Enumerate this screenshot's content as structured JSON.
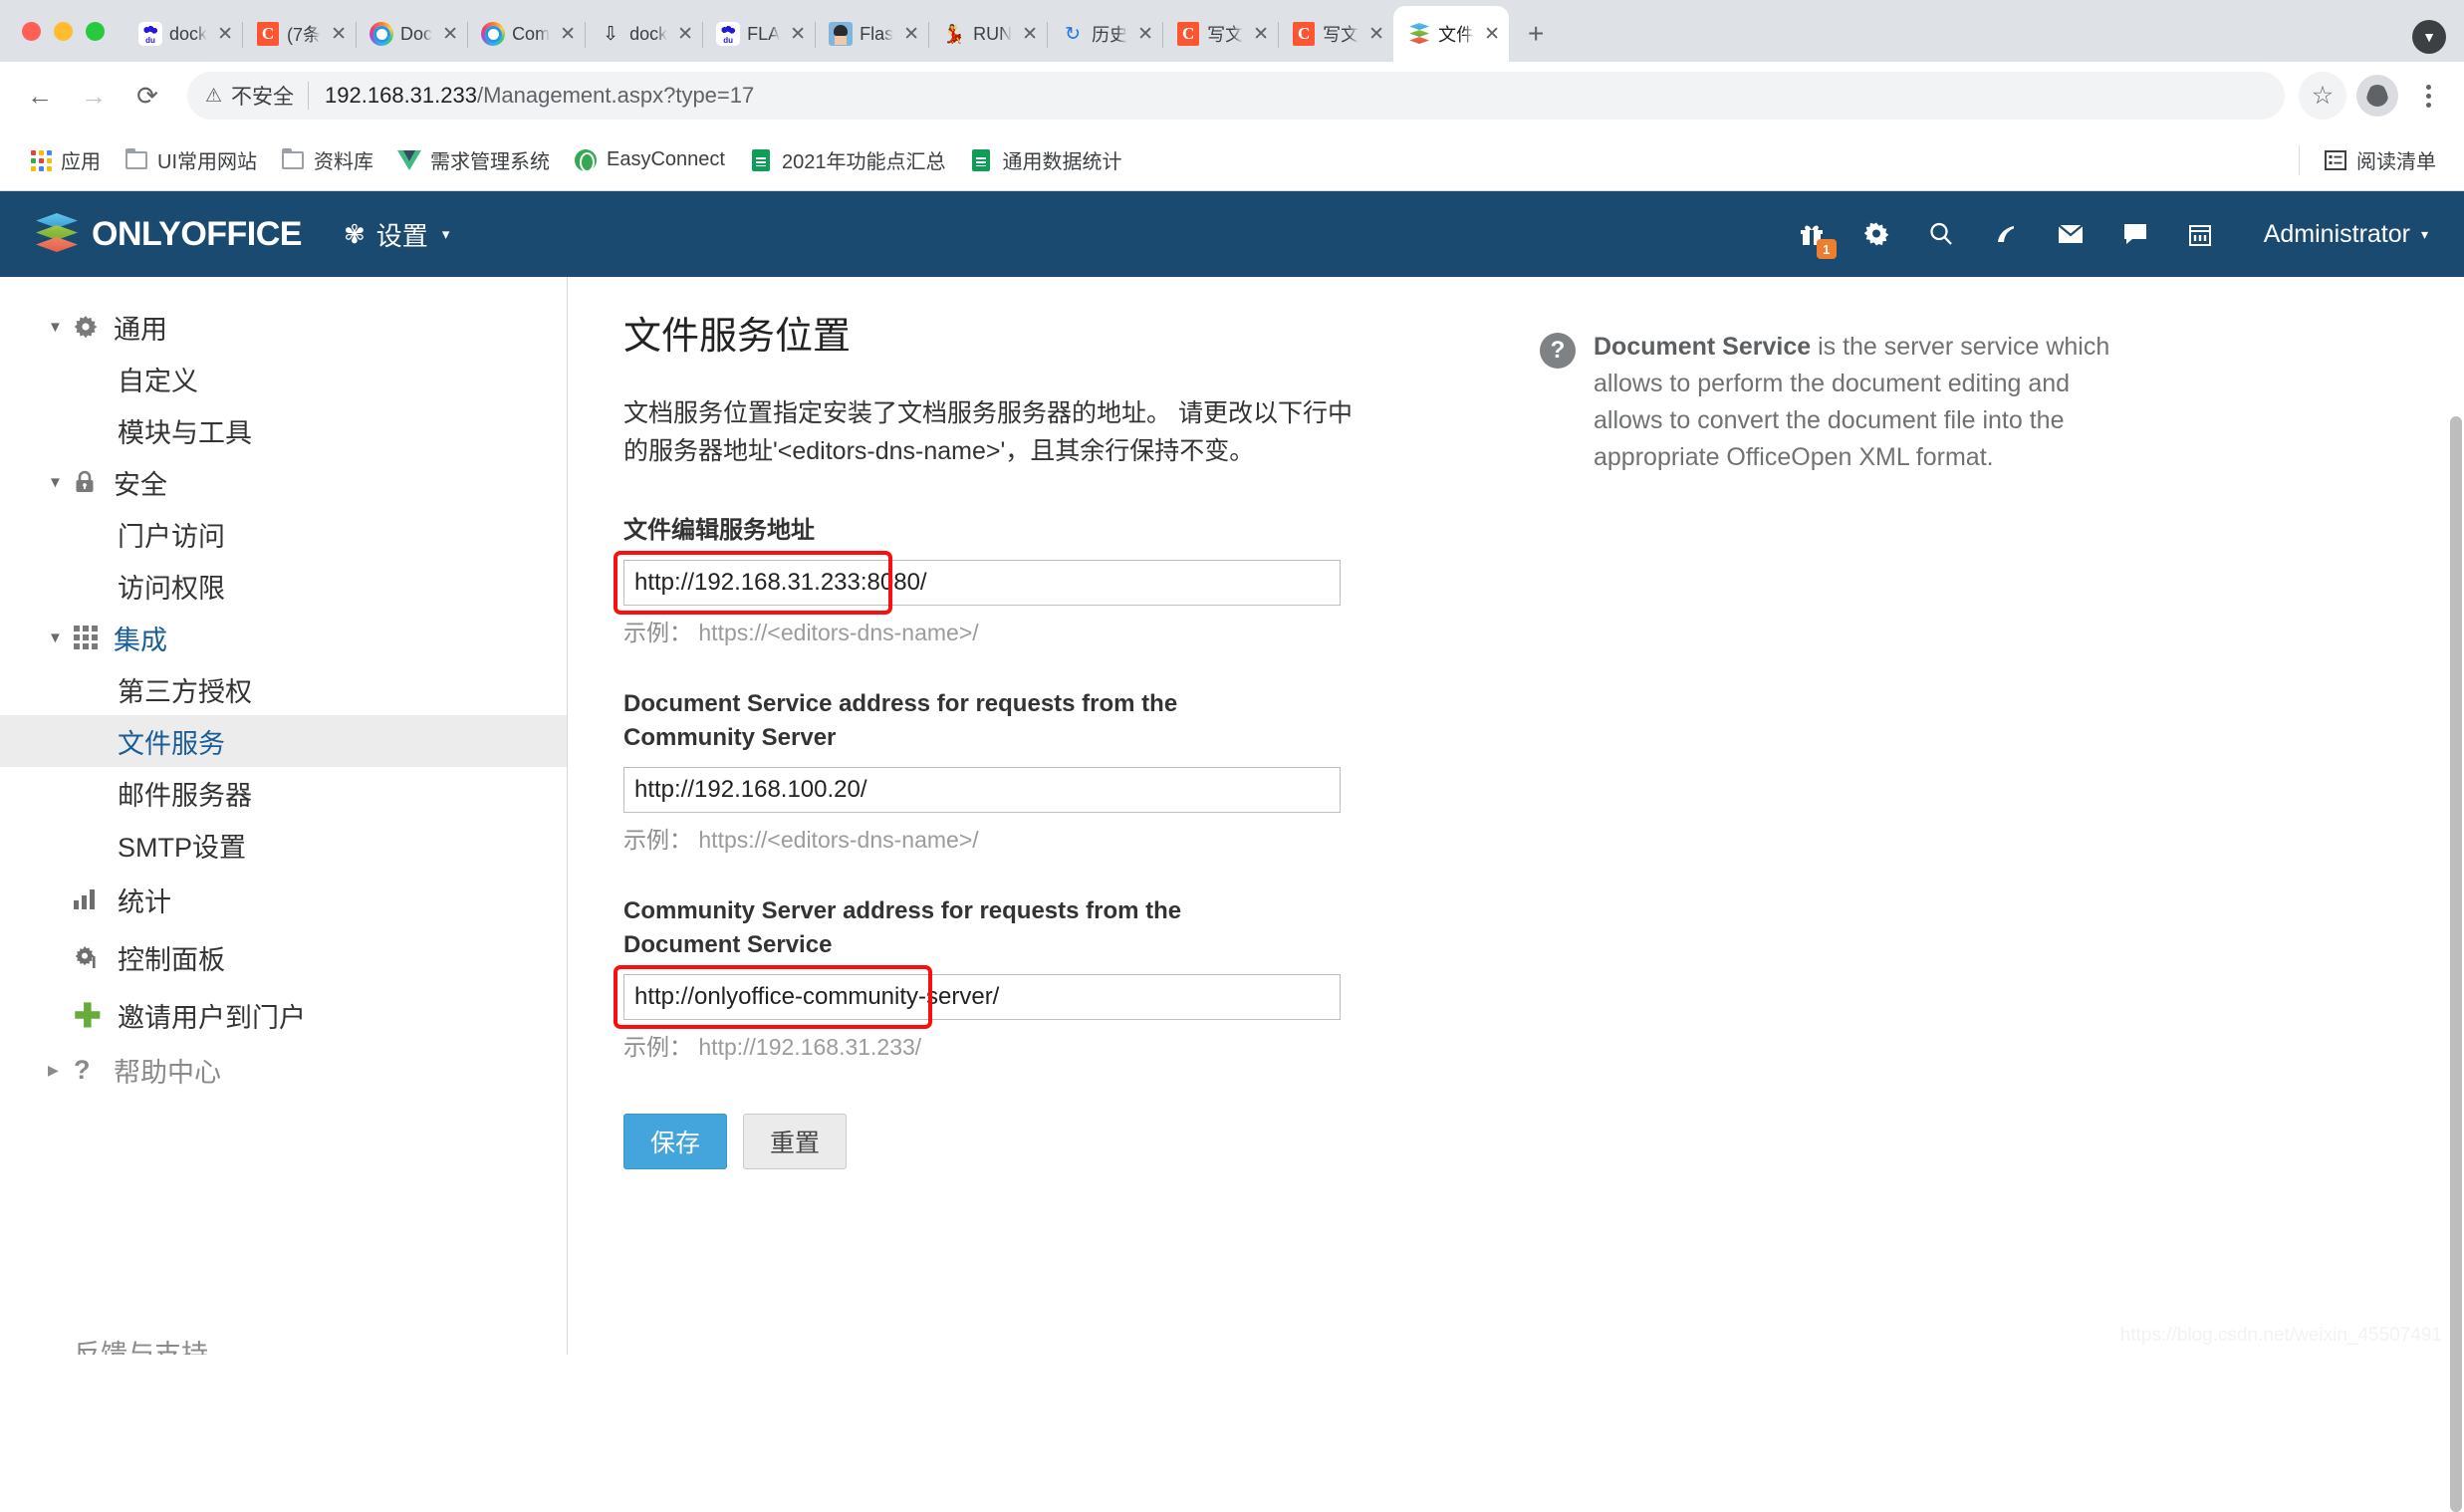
{
  "browser": {
    "tabs": [
      {
        "title": "dock",
        "favicon": "baidu-icon",
        "active": false
      },
      {
        "title": "(7条",
        "favicon": "csdn-icon",
        "active": false
      },
      {
        "title": "Doc",
        "favicon": "docker-icon",
        "active": false
      },
      {
        "title": "Com",
        "favicon": "docker-icon",
        "active": false
      },
      {
        "title": "dock",
        "favicon": "hand-icon",
        "active": false
      },
      {
        "title": "FLA",
        "favicon": "baidu-icon",
        "active": false
      },
      {
        "title": "Flas",
        "favicon": "avatar-icon",
        "active": false
      },
      {
        "title": "RUN",
        "favicon": "run-icon",
        "active": false
      },
      {
        "title": "历史",
        "favicon": "history-icon",
        "active": false
      },
      {
        "title": "写文",
        "favicon": "csdn-icon",
        "active": false
      },
      {
        "title": "写文",
        "favicon": "csdn-icon",
        "active": false
      },
      {
        "title": "文件",
        "favicon": "onlyoffice-icon",
        "active": true
      }
    ],
    "new_tab_label": "+",
    "tab_close_label": "✕",
    "tab_list_caret": "▼",
    "back_label": "←",
    "forward_label": "→",
    "reload_label": "⟳",
    "security": {
      "icon": "warning-triangle-icon",
      "icon_glyph": "⚠",
      "label": "不安全"
    },
    "url_host": "192.168.31.233",
    "url_path": "/Management.aspx?type=17",
    "star_label": "☆",
    "bookmarks": [
      {
        "label": "应用",
        "icon": "apps-grid-icon"
      },
      {
        "label": "UI常用网站",
        "icon": "folder-icon"
      },
      {
        "label": "资料库",
        "icon": "folder-icon"
      },
      {
        "label": "需求管理系统",
        "icon": "vue-icon"
      },
      {
        "label": "EasyConnect",
        "icon": "globe-icon"
      },
      {
        "label": "2021年功能点汇总",
        "icon": "sheets-icon"
      },
      {
        "label": "通用数据统计",
        "icon": "sheets-icon"
      }
    ],
    "reading_list": {
      "label": "阅读清单",
      "icon": "reading-list-icon"
    }
  },
  "app": {
    "brand": "ONLYOFFICE",
    "settings_menu": {
      "label": "设置",
      "icon": "gear-icon",
      "caret": "▾"
    },
    "header_icons": [
      {
        "name": "gift-icon",
        "glyph": "🎁",
        "badge": "1"
      },
      {
        "name": "gear-icon",
        "glyph": "✿",
        "badge": ""
      },
      {
        "name": "search-icon",
        "glyph": "⌕",
        "badge": ""
      },
      {
        "name": "feed-icon",
        "glyph": "◜",
        "badge": ""
      },
      {
        "name": "mail-icon",
        "glyph": "✉",
        "badge": ""
      },
      {
        "name": "chat-icon",
        "glyph": "▭",
        "badge": ""
      },
      {
        "name": "calendar-icon",
        "glyph": "▦",
        "badge": ""
      }
    ],
    "user": {
      "name": "Administrator",
      "caret": "▾"
    },
    "accent_color": "#1b4a71",
    "link_color": "#1a5c96"
  },
  "sidebar": {
    "groups": [
      {
        "label": "通用",
        "icon": "gear-icon",
        "caret": "▼",
        "expanded": true,
        "active": false,
        "children": [
          {
            "label": "自定义",
            "selected": false
          },
          {
            "label": "模块与工具",
            "selected": false
          }
        ]
      },
      {
        "label": "安全",
        "icon": "lock-icon",
        "caret": "▼",
        "expanded": true,
        "active": false,
        "children": [
          {
            "label": "门户访问",
            "selected": false
          },
          {
            "label": "访问权限",
            "selected": false
          }
        ]
      },
      {
        "label": "集成",
        "icon": "grid-icon",
        "caret": "▼",
        "expanded": true,
        "active": true,
        "children": [
          {
            "label": "第三方授权",
            "selected": false
          },
          {
            "label": "文件服务",
            "selected": true
          },
          {
            "label": "邮件服务器",
            "selected": false
          },
          {
            "label": "SMTP设置",
            "selected": false
          }
        ]
      }
    ],
    "leaves": [
      {
        "label": "统计",
        "icon": "bar-chart-icon",
        "dim": false
      },
      {
        "label": "控制面板",
        "icon": "control-panel-icon",
        "dim": false
      },
      {
        "label": "邀请用户到门户",
        "icon": "plus-icon",
        "dim": false
      }
    ],
    "collapsed": [
      {
        "label": "帮助中心",
        "icon": "question-icon",
        "caret": "▶",
        "dim": true
      }
    ],
    "cut_off_label": "反馈与支持"
  },
  "main": {
    "title": "文件服务位置",
    "intro": "文档服务位置指定安装了文档服务服务器的地址。 请更改以下行中的服务器地址'<editors-dns-name>'，且其余行保持不变。",
    "fields": [
      {
        "label": "文件编辑服务地址",
        "value": "http://192.168.31.233:8080/",
        "hint_label": "示例：",
        "hint_value": "https://<editors-dns-name>/",
        "highlighted": true
      },
      {
        "label": "Document Service address for requests from the Community Server",
        "value": "http://192.168.100.20/",
        "hint_label": "示例：",
        "hint_value": "https://<editors-dns-name>/",
        "highlighted": false
      },
      {
        "label": "Community Server address for requests from the Document Service",
        "value": "http://onlyoffice-community-server/",
        "hint_label": "示例：",
        "hint_value": "http://192.168.31.233/",
        "highlighted": true
      }
    ],
    "save_label": "保存",
    "reset_label": "重置",
    "highlight_color": "#fd0d0d"
  },
  "aside": {
    "help_icon": "question-mark-icon",
    "help_glyph": "?",
    "help_bold": "Document Service",
    "help_text": " is the server service which allows to perform the document editing and allows to convert the document file into the appropriate OfficeOpen XML format."
  },
  "watermark": "https://blog.csdn.net/weixin_45507491"
}
